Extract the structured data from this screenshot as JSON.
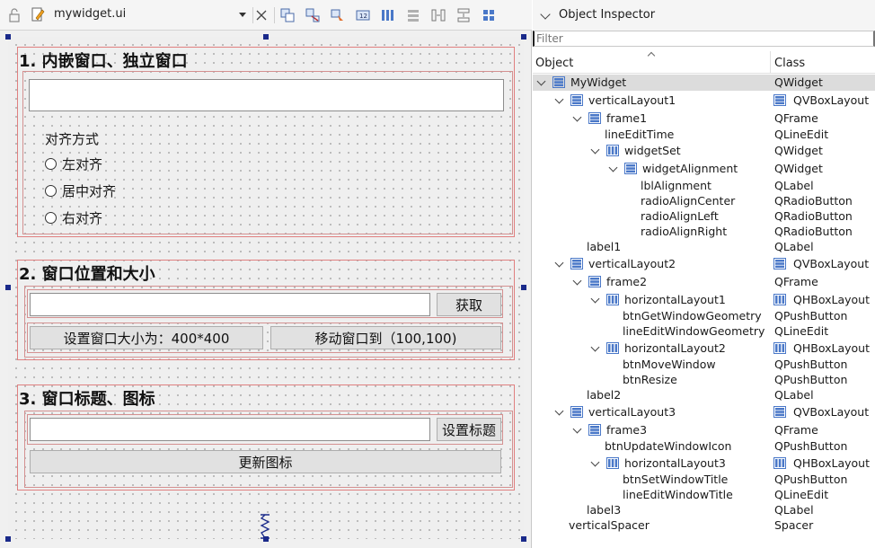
{
  "toolbar": {
    "file_name": "mywidget.ui",
    "icons": [
      "lock-icon",
      "edit-file-icon",
      "close-icon",
      "edit-widgets-icon",
      "edit-signals-icon",
      "edit-buddies-icon",
      "edit-tab-order-icon",
      "layout-horizontal-icon",
      "layout-vertical-icon",
      "layout-horizontal-splitter-icon",
      "layout-vertical-splitter-icon",
      "layout-grid-icon"
    ]
  },
  "form": {
    "section1": {
      "title": "1. 内嵌窗口、独立窗口",
      "align_label": "对齐方式",
      "radios": [
        "左对齐",
        "居中对齐",
        "右对齐"
      ]
    },
    "section2": {
      "title": "2. 窗口位置和大小",
      "get_button": "获取",
      "resize_button": "设置窗口大小为：400*400",
      "move_button": "移动窗口到（100,100)"
    },
    "section3": {
      "title": "3. 窗口标题、图标",
      "set_title_button": "设置标题",
      "update_icon_button": "更新图标"
    }
  },
  "inspector": {
    "title": "Object Inspector",
    "filter_placeholder": "Filter",
    "col_object": "Object",
    "col_class": "Class",
    "rows": [
      {
        "name": "MyWidget",
        "cls": "QWidget",
        "depth": 0,
        "exp": true,
        "icon": "widget",
        "cls_icon": false,
        "sel": true
      },
      {
        "name": "verticalLayout1",
        "cls": "QVBoxLayout",
        "depth": 1,
        "exp": true,
        "icon": "vbox",
        "cls_icon": true
      },
      {
        "name": "frame1",
        "cls": "QFrame",
        "depth": 2,
        "exp": true,
        "icon": "vbox",
        "cls_icon": false
      },
      {
        "name": "lineEditTime",
        "cls": "QLineEdit",
        "depth": 3,
        "exp": false,
        "icon": "none",
        "cls_icon": false
      },
      {
        "name": "widgetSet",
        "cls": "QWidget",
        "depth": 3,
        "exp": true,
        "icon": "hbox",
        "cls_icon": false
      },
      {
        "name": "widgetAlignment",
        "cls": "QWidget",
        "depth": 4,
        "exp": true,
        "icon": "vbox",
        "cls_icon": false
      },
      {
        "name": "lblAlignment",
        "cls": "QLabel",
        "depth": 5,
        "exp": false,
        "icon": "none",
        "cls_icon": false
      },
      {
        "name": "radioAlignCenter",
        "cls": "QRadioButton",
        "depth": 5,
        "exp": false,
        "icon": "none",
        "cls_icon": false
      },
      {
        "name": "radioAlignLeft",
        "cls": "QRadioButton",
        "depth": 5,
        "exp": false,
        "icon": "none",
        "cls_icon": false
      },
      {
        "name": "radioAlignRight",
        "cls": "QRadioButton",
        "depth": 5,
        "exp": false,
        "icon": "none",
        "cls_icon": false
      },
      {
        "name": "label1",
        "cls": "QLabel",
        "depth": 2,
        "exp": false,
        "icon": "none",
        "cls_icon": false
      },
      {
        "name": "verticalLayout2",
        "cls": "QVBoxLayout",
        "depth": 1,
        "exp": true,
        "icon": "vbox",
        "cls_icon": true
      },
      {
        "name": "frame2",
        "cls": "QFrame",
        "depth": 2,
        "exp": true,
        "icon": "vbox",
        "cls_icon": false
      },
      {
        "name": "horizontalLayout1",
        "cls": "QHBoxLayout",
        "depth": 3,
        "exp": true,
        "icon": "hbox",
        "cls_icon": true
      },
      {
        "name": "btnGetWindowGeometry",
        "cls": "QPushButton",
        "depth": 4,
        "exp": false,
        "icon": "none",
        "cls_icon": false
      },
      {
        "name": "lineEditWindowGeometry",
        "cls": "QLineEdit",
        "depth": 4,
        "exp": false,
        "icon": "none",
        "cls_icon": false
      },
      {
        "name": "horizontalLayout2",
        "cls": "QHBoxLayout",
        "depth": 3,
        "exp": true,
        "icon": "hbox",
        "cls_icon": true
      },
      {
        "name": "btnMoveWindow",
        "cls": "QPushButton",
        "depth": 4,
        "exp": false,
        "icon": "none",
        "cls_icon": false
      },
      {
        "name": "btnResize",
        "cls": "QPushButton",
        "depth": 4,
        "exp": false,
        "icon": "none",
        "cls_icon": false
      },
      {
        "name": "label2",
        "cls": "QLabel",
        "depth": 2,
        "exp": false,
        "icon": "none",
        "cls_icon": false
      },
      {
        "name": "verticalLayout3",
        "cls": "QVBoxLayout",
        "depth": 1,
        "exp": true,
        "icon": "vbox",
        "cls_icon": true
      },
      {
        "name": "frame3",
        "cls": "QFrame",
        "depth": 2,
        "exp": true,
        "icon": "vbox",
        "cls_icon": false
      },
      {
        "name": "btnUpdateWindowIcon",
        "cls": "QPushButton",
        "depth": 3,
        "exp": false,
        "icon": "none",
        "cls_icon": false
      },
      {
        "name": "horizontalLayout3",
        "cls": "QHBoxLayout",
        "depth": 3,
        "exp": true,
        "icon": "hbox",
        "cls_icon": true
      },
      {
        "name": "btnSetWindowTitle",
        "cls": "QPushButton",
        "depth": 4,
        "exp": false,
        "icon": "none",
        "cls_icon": false
      },
      {
        "name": "lineEditWindowTitle",
        "cls": "QLineEdit",
        "depth": 4,
        "exp": false,
        "icon": "none",
        "cls_icon": false
      },
      {
        "name": "label3",
        "cls": "QLabel",
        "depth": 2,
        "exp": false,
        "icon": "none",
        "cls_icon": false
      },
      {
        "name": "verticalSpacer",
        "cls": "Spacer",
        "depth": 1,
        "exp": false,
        "icon": "none",
        "cls_icon": false
      }
    ]
  },
  "colors": {
    "frame_border": "#e08080",
    "handle": "#1a2a8a",
    "layout_icon": "#4a78c8",
    "selection": "#dcdcdc"
  }
}
